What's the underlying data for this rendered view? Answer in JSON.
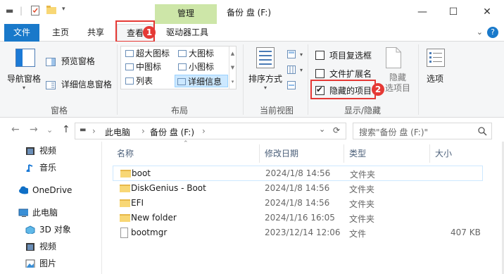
{
  "titlebar": {
    "manage_tab": "管理",
    "title": "备份 盘 (F:)",
    "minimize": "—",
    "maximize": "☐",
    "close": "✕"
  },
  "tabs": {
    "file": "文件",
    "home": "主页",
    "share": "共享",
    "view": "查看",
    "drive_tools": "驱动器工具",
    "chevron": "⌄",
    "help": "?"
  },
  "ribbon": {
    "panes": {
      "nav_pane": "导航窗格",
      "preview_pane": "预览窗格",
      "details_pane": "详细信息窗格",
      "label": "窗格"
    },
    "layout": {
      "items": [
        "超大图标",
        "大图标",
        "中图标",
        "小图标",
        "列表",
        "详细信息"
      ],
      "selected": "详细信息",
      "label": "布局"
    },
    "current_view": {
      "sort_by": "排序方式",
      "label": "当前视图"
    },
    "show_hide": {
      "item_checkboxes": "项目复选框",
      "file_extensions": "文件扩展名",
      "hidden_items": "隐藏的项目",
      "item_checkboxes_checked": false,
      "file_extensions_checked": false,
      "hidden_items_checked": true,
      "hide_selected": "隐藏",
      "selected_items": "选项目",
      "label": "显示/隐藏"
    },
    "options": "选项"
  },
  "badges": {
    "one": "1",
    "two": "2"
  },
  "address": {
    "back": "←",
    "forward": "→",
    "recent": "⌄",
    "up": "↑",
    "path_pc": "此电脑",
    "path_drive": "备份 盘 (F:)",
    "sep": "›",
    "dropdown": "⌄",
    "refresh": "⟳",
    "search_placeholder": "搜索\"备份 盘 (F:)\"",
    "search_icon": "search-icon"
  },
  "navpane": {
    "items": [
      "视频",
      "音乐",
      "OneDrive",
      "此电脑",
      "3D 对象",
      "视频",
      "图片"
    ]
  },
  "filelist": {
    "headers": {
      "name": "名称",
      "modified": "修改日期",
      "type": "类型",
      "size": "大小"
    },
    "rows": [
      {
        "name": "boot",
        "modified": "2024/1/8 14:56",
        "type": "文件夹",
        "size": "",
        "kind": "folder"
      },
      {
        "name": "DiskGenius - Boot",
        "modified": "2024/1/8 14:56",
        "type": "文件夹",
        "size": "",
        "kind": "folder"
      },
      {
        "name": "EFI",
        "modified": "2024/1/8 14:56",
        "type": "文件夹",
        "size": "",
        "kind": "folder"
      },
      {
        "name": "New folder",
        "modified": "2024/1/16 16:05",
        "type": "文件夹",
        "size": "",
        "kind": "folder"
      },
      {
        "name": "bootmgr",
        "modified": "2023/12/14 12:06",
        "type": "文件",
        "size": "407 KB",
        "kind": "file"
      }
    ]
  },
  "colors": {
    "accent": "#1979ca",
    "manage_tab": "#cde6a8",
    "highlight_red": "#e53935"
  }
}
